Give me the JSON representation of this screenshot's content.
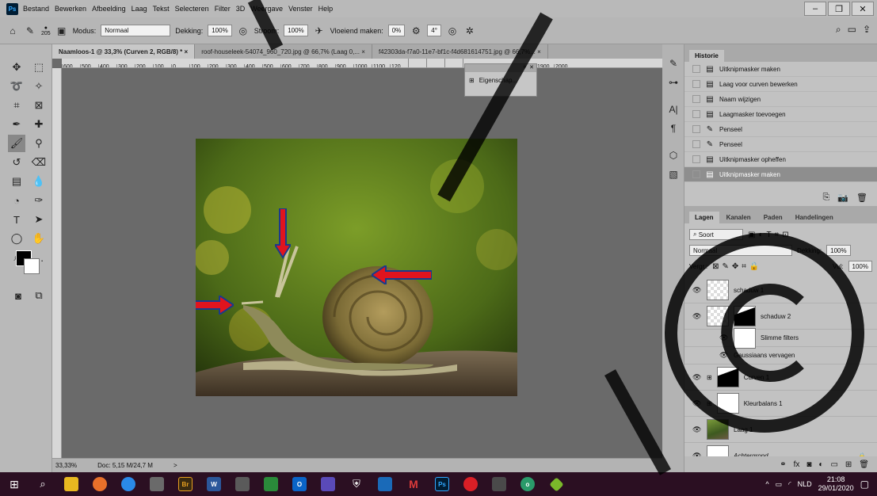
{
  "menubar": {
    "logo": "Ps",
    "items": [
      "Bestand",
      "Bewerken",
      "Afbeelding",
      "Laag",
      "Tekst",
      "Selecteren",
      "Filter",
      "3D",
      "Weergave",
      "Venster",
      "Help"
    ]
  },
  "options": {
    "brush_size": "205",
    "modus_label": "Modus:",
    "modus_value": "Normaal",
    "dekking_label": "Dekking:",
    "dekking_value": "100%",
    "stroom_label": "Stroom:",
    "stroom_value": "100%",
    "vloeiend_label": "Vloeiend maken:",
    "vloeiend_value": "0%",
    "angle_value": "4°"
  },
  "tabs": [
    {
      "label": "Naamloos-1 @ 33,3% (Curven 2, RGB/8) *",
      "close": "×"
    },
    {
      "label": "roof-houseleek-54074_960_720.jpg @ 66,7% (Laag 0,...",
      "close": "×"
    },
    {
      "label": "f42303da-f7a0-11e7-bf1c-f4d681614751.jpg @ 66,7%...",
      "close": "×"
    }
  ],
  "ruler_ticks": [
    "600",
    "500",
    "400",
    "300",
    "200",
    "100",
    "0",
    "100",
    "200",
    "300",
    "400",
    "500",
    "600",
    "700",
    "800",
    "900",
    "1000",
    "1100",
    "120",
    "",
    "",
    "",
    "",
    "1600",
    "1700",
    "1800",
    "1900",
    "2000"
  ],
  "float_panel": {
    "label": "Eigenschap..."
  },
  "status": {
    "zoom": "33,33%",
    "doc": "Doc: 5,15 M/24,7 M",
    "chevron": ">"
  },
  "history": {
    "tab": "Historie",
    "items": [
      {
        "label": "Uitknipmasker maken",
        "icon": "doc"
      },
      {
        "label": "Laag voor curven bewerken",
        "icon": "doc"
      },
      {
        "label": "Naam wijzigen",
        "icon": "doc"
      },
      {
        "label": "Laagmasker toevoegen",
        "icon": "doc"
      },
      {
        "label": "Penseel",
        "icon": "brush"
      },
      {
        "label": "Penseel",
        "icon": "brush"
      },
      {
        "label": "Uitknipmasker opheffen",
        "icon": "doc"
      },
      {
        "label": "Uitknipmasker maken",
        "icon": "doc",
        "selected": true
      }
    ]
  },
  "layers_panel": {
    "tabs": [
      "Lagen",
      "Kanalen",
      "Paden",
      "Handelingen"
    ],
    "filter_label": "Soort",
    "blend_mode": "Normaal",
    "opacity_label": "Dekking:",
    "opacity_value": "100%",
    "lock_label": "Vergr.:",
    "fill_label": "Vul:",
    "fill_value": "100%",
    "layers": [
      {
        "name": "schaduw 1",
        "thumb": "checker",
        "sub": false
      },
      {
        "name": "schaduw 2",
        "thumb": "checker",
        "sub": false,
        "mask": true
      },
      {
        "name": "Slimme filters",
        "thumb": "white",
        "sub": true
      },
      {
        "name": "Gaussiaans vervagen",
        "thumb": "none",
        "sub": true
      },
      {
        "name": "Curven 1",
        "thumb": "black",
        "sub": false,
        "adj": true
      },
      {
        "name": "Kleurbalans 1",
        "thumb": "white",
        "sub": false,
        "adj": true
      },
      {
        "name": "Laag 1",
        "thumb": "photo",
        "sub": false
      },
      {
        "name": "Achtergrond",
        "thumb": "white",
        "sub": false,
        "locked": true
      }
    ]
  },
  "tray": {
    "lang": "NLD",
    "time": "21:08",
    "date": "29/01/2020"
  },
  "colors": {
    "taskbar": "#2b0f22",
    "accent_red": "#e0141e",
    "arrow_outline": "#1a3a8c"
  }
}
